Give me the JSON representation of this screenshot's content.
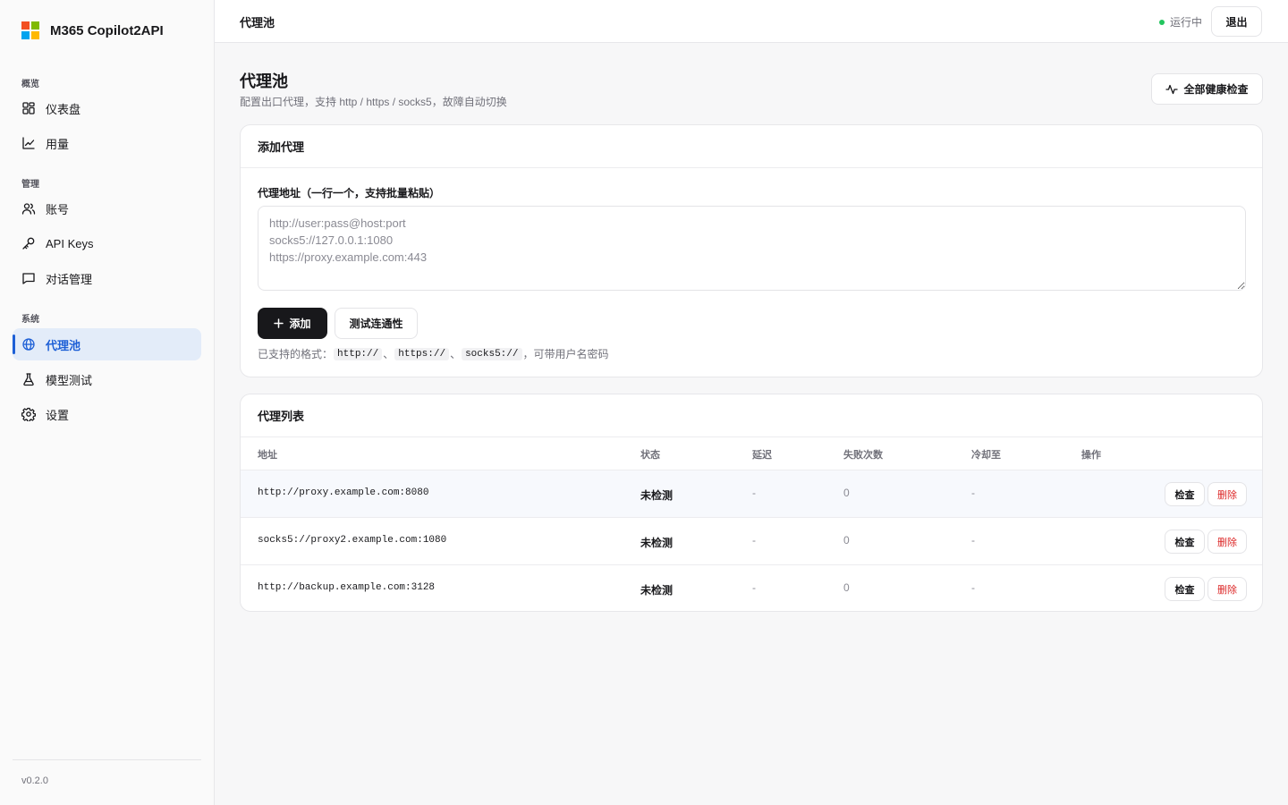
{
  "app": {
    "name": "M365 Copilot2API",
    "version": "v0.2.0",
    "logo_colors": [
      "#f25022",
      "#7fba00",
      "#00a4ef",
      "#ffb900"
    ]
  },
  "sidebar": {
    "groups": [
      {
        "label": "概览",
        "items": [
          {
            "label": "仪表盘",
            "icon": "dashboard-icon"
          },
          {
            "label": "用量",
            "icon": "chart-line-icon"
          }
        ]
      },
      {
        "label": "管理",
        "items": [
          {
            "label": "账号",
            "icon": "users-icon"
          },
          {
            "label": "API Keys",
            "icon": "key-icon"
          },
          {
            "label": "对话管理",
            "icon": "message-icon"
          }
        ]
      },
      {
        "label": "系统",
        "items": [
          {
            "label": "代理池",
            "icon": "globe-icon",
            "active": true
          },
          {
            "label": "模型测试",
            "icon": "flask-icon"
          },
          {
            "label": "设置",
            "icon": "gear-icon"
          }
        ]
      }
    ]
  },
  "topbar": {
    "title": "代理池",
    "status_text": "运行中",
    "status_color": "#22c55e",
    "logout_label": "退出"
  },
  "page": {
    "title": "代理池",
    "subtitle": "配置出口代理，支持 http / https / socks5，故障自动切换",
    "health_check_label": "全部健康检查"
  },
  "add_proxy": {
    "title": "添加代理",
    "field_label": "代理地址（一行一个，支持批量粘贴）",
    "placeholder": "http://user:pass@host:port\nsocks5://127.0.0.1:1080\nhttps://proxy.example.com:443",
    "value": "",
    "add_label": "添加",
    "test_label": "测试连通性",
    "hint_prefix": "已支持的格式：",
    "formats": [
      "http://",
      "https://",
      "socks5://"
    ],
    "separator": "、",
    "hint_suffix": "，可带用户名密码"
  },
  "proxy_list": {
    "title": "代理列表",
    "columns": [
      "地址",
      "状态",
      "延迟",
      "失败次数",
      "冷却至",
      "操作"
    ],
    "rows": [
      {
        "address": "http://proxy.example.com:8080",
        "status": "未检测",
        "latency": "-",
        "failures": "0",
        "cooldown": "-"
      },
      {
        "address": "socks5://proxy2.example.com:1080",
        "status": "未检测",
        "latency": "-",
        "failures": "0",
        "cooldown": "-"
      },
      {
        "address": "http://backup.example.com:3128",
        "status": "未检测",
        "latency": "-",
        "failures": "0",
        "cooldown": "-"
      }
    ],
    "check_label": "检查",
    "delete_label": "删除",
    "delete_color": "#dc2626"
  }
}
